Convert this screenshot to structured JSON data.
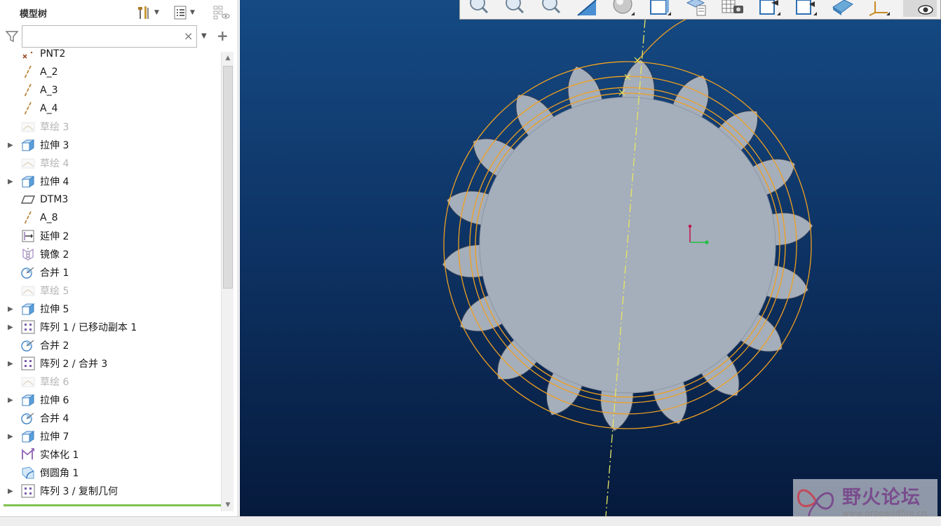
{
  "panel": {
    "title": "模型树",
    "search": {
      "value": "",
      "placeholder": "",
      "clear_label": "×",
      "add_label": "+"
    }
  },
  "tree": {
    "items": [
      {
        "label": "PNT2",
        "icon": "datum-point-icon",
        "expandable": false,
        "dim": false
      },
      {
        "label": "A_2",
        "icon": "datum-axis-icon",
        "expandable": false,
        "dim": false
      },
      {
        "label": "A_3",
        "icon": "datum-axis-icon",
        "expandable": false,
        "dim": false
      },
      {
        "label": "A_4",
        "icon": "datum-axis-icon",
        "expandable": false,
        "dim": false
      },
      {
        "label": "草绘 3",
        "icon": "sketch-icon",
        "expandable": false,
        "dim": true
      },
      {
        "label": "拉伸 3",
        "icon": "extrude-icon",
        "expandable": true,
        "dim": false
      },
      {
        "label": "草绘 4",
        "icon": "sketch-icon",
        "expandable": false,
        "dim": true
      },
      {
        "label": "拉伸 4",
        "icon": "extrude-icon",
        "expandable": true,
        "dim": false
      },
      {
        "label": "DTM3",
        "icon": "datum-plane-icon",
        "expandable": false,
        "dim": false
      },
      {
        "label": "A_8",
        "icon": "datum-axis-icon",
        "expandable": false,
        "dim": false
      },
      {
        "label": "延伸 2",
        "icon": "extend-icon",
        "expandable": false,
        "dim": false
      },
      {
        "label": "镜像 2",
        "icon": "mirror-icon",
        "expandable": false,
        "dim": false
      },
      {
        "label": "合并 1",
        "icon": "merge-icon",
        "expandable": false,
        "dim": false
      },
      {
        "label": "草绘 5",
        "icon": "sketch-icon",
        "expandable": false,
        "dim": true
      },
      {
        "label": "拉伸 5",
        "icon": "extrude-icon",
        "expandable": true,
        "dim": false
      },
      {
        "label": "阵列 1 / 已移动副本 1",
        "icon": "pattern-icon",
        "expandable": true,
        "dim": false
      },
      {
        "label": "合并 2",
        "icon": "merge-icon",
        "expandable": false,
        "dim": false
      },
      {
        "label": "阵列 2 / 合并 3",
        "icon": "pattern-icon",
        "expandable": true,
        "dim": false
      },
      {
        "label": "草绘 6",
        "icon": "sketch-icon",
        "expandable": false,
        "dim": true
      },
      {
        "label": "拉伸 6",
        "icon": "extrude-icon",
        "expandable": true,
        "dim": false
      },
      {
        "label": "合并 4",
        "icon": "merge-icon",
        "expandable": false,
        "dim": false
      },
      {
        "label": "拉伸 7",
        "icon": "extrude-icon",
        "expandable": true,
        "dim": false
      },
      {
        "label": "实体化 1",
        "icon": "solidify-icon",
        "expandable": false,
        "dim": false
      },
      {
        "label": "倒圆角 1",
        "icon": "round-icon",
        "expandable": false,
        "dim": false
      },
      {
        "label": "阵列 3 / 复制几何",
        "icon": "pattern-icon",
        "expandable": true,
        "dim": false
      }
    ]
  },
  "viewport": {
    "gear": {
      "teeth": 18
    }
  },
  "colors": {
    "viewport_top": "#154a83",
    "viewport_bottom": "#061a3c",
    "gear_fill": "#a5aebb",
    "datum_curve": "#f0a020",
    "datum_axis": "#e8e860",
    "accent_green": "#7ec24f"
  },
  "watermark": {
    "title": "野火论坛",
    "url": "www.proewildfire.cn"
  }
}
